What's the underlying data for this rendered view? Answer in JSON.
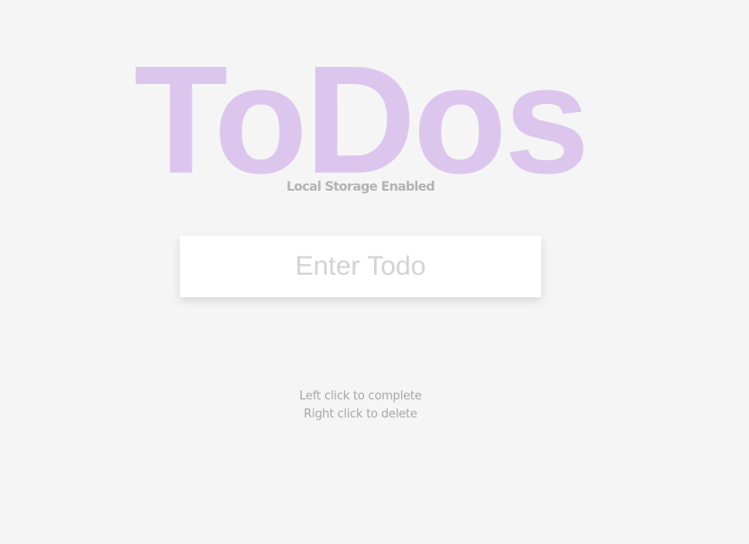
{
  "header": {
    "title": "ToDos",
    "subtitle": "Local Storage Enabled"
  },
  "form": {
    "input_placeholder": "Enter Todo",
    "input_value": ""
  },
  "todos": [],
  "hints": {
    "complete": "Left click to complete",
    "delete": "Right click to delete"
  },
  "colors": {
    "background": "#f5f5f5",
    "title": "#dcc6ee",
    "subtitle": "#b3b3b3",
    "hint": "#a8a8a8",
    "placeholder": "#d3d3d3"
  }
}
